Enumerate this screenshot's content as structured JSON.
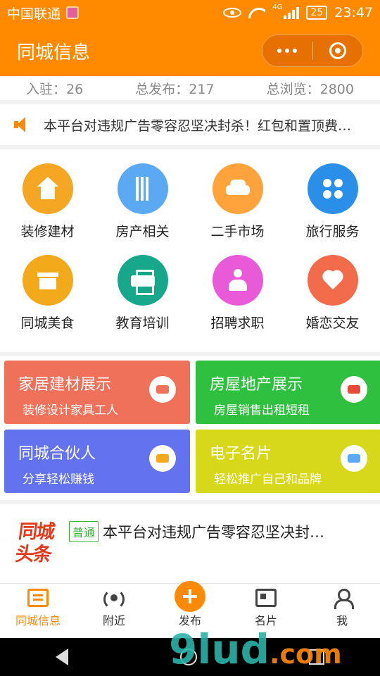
{
  "status_bar": {
    "carrier": "中国联通",
    "network": "4G",
    "battery": "25",
    "time": "23:47"
  },
  "header": {
    "title": "同城信息"
  },
  "stats": [
    {
      "label": "入驻：",
      "value": "26"
    },
    {
      "label": "总发布：",
      "value": "217"
    },
    {
      "label": "总浏览：",
      "value": "2800"
    }
  ],
  "notice": {
    "text": "本平台对违规广告零容忍坚决封杀！红包和置顶费…"
  },
  "categories": [
    {
      "label": "装修建材",
      "icon": "house-icon",
      "color": "#f5a623"
    },
    {
      "label": "房产相关",
      "icon": "building-icon",
      "color": "#5aa9f2"
    },
    {
      "label": "二手市场",
      "icon": "car-icon",
      "color": "#ffa33a"
    },
    {
      "label": "旅行服务",
      "icon": "clover-icon",
      "color": "#2a8fe8"
    },
    {
      "label": "同城美食",
      "icon": "shop-icon",
      "color": "#f2a91a"
    },
    {
      "label": "教育培训",
      "icon": "printer-icon",
      "color": "#17a78a"
    },
    {
      "label": "招聘求职",
      "icon": "person-icon",
      "color": "#e85ad8"
    },
    {
      "label": "婚恋交友",
      "icon": "heart-icon",
      "color": "#f26b4b"
    }
  ],
  "promos": [
    {
      "title": "家居建材展示",
      "subtitle": "装修设计家具工人",
      "color": "#f0715a",
      "icon": "car-icon"
    },
    {
      "title": "房屋地产展示",
      "subtitle": "房屋销售出租短租",
      "color": "#2ec03e",
      "icon": "gift-icon"
    },
    {
      "title": "同城合伙人",
      "subtitle": "分享轻松赚钱",
      "color": "#6372ee",
      "icon": "search-user-icon"
    },
    {
      "title": "电子名片",
      "subtitle": "轻松推广自己和品牌",
      "color": "#d8d81a",
      "icon": "building-icon"
    }
  ],
  "headline": {
    "logo_line1": "同城",
    "logo_line2": "头条",
    "badge": "普通",
    "text": "本平台对违规广告零容忍坚决封…"
  },
  "tabs": [
    {
      "label": "同城信息",
      "icon": "list-icon"
    },
    {
      "label": "附近",
      "icon": "radio-icon"
    },
    {
      "label": "发布",
      "icon": "plus-icon"
    },
    {
      "label": "名片",
      "icon": "card-icon"
    },
    {
      "label": "我",
      "icon": "user-icon"
    }
  ],
  "watermark": {
    "main": "9lud",
    "suffix": ".com"
  }
}
